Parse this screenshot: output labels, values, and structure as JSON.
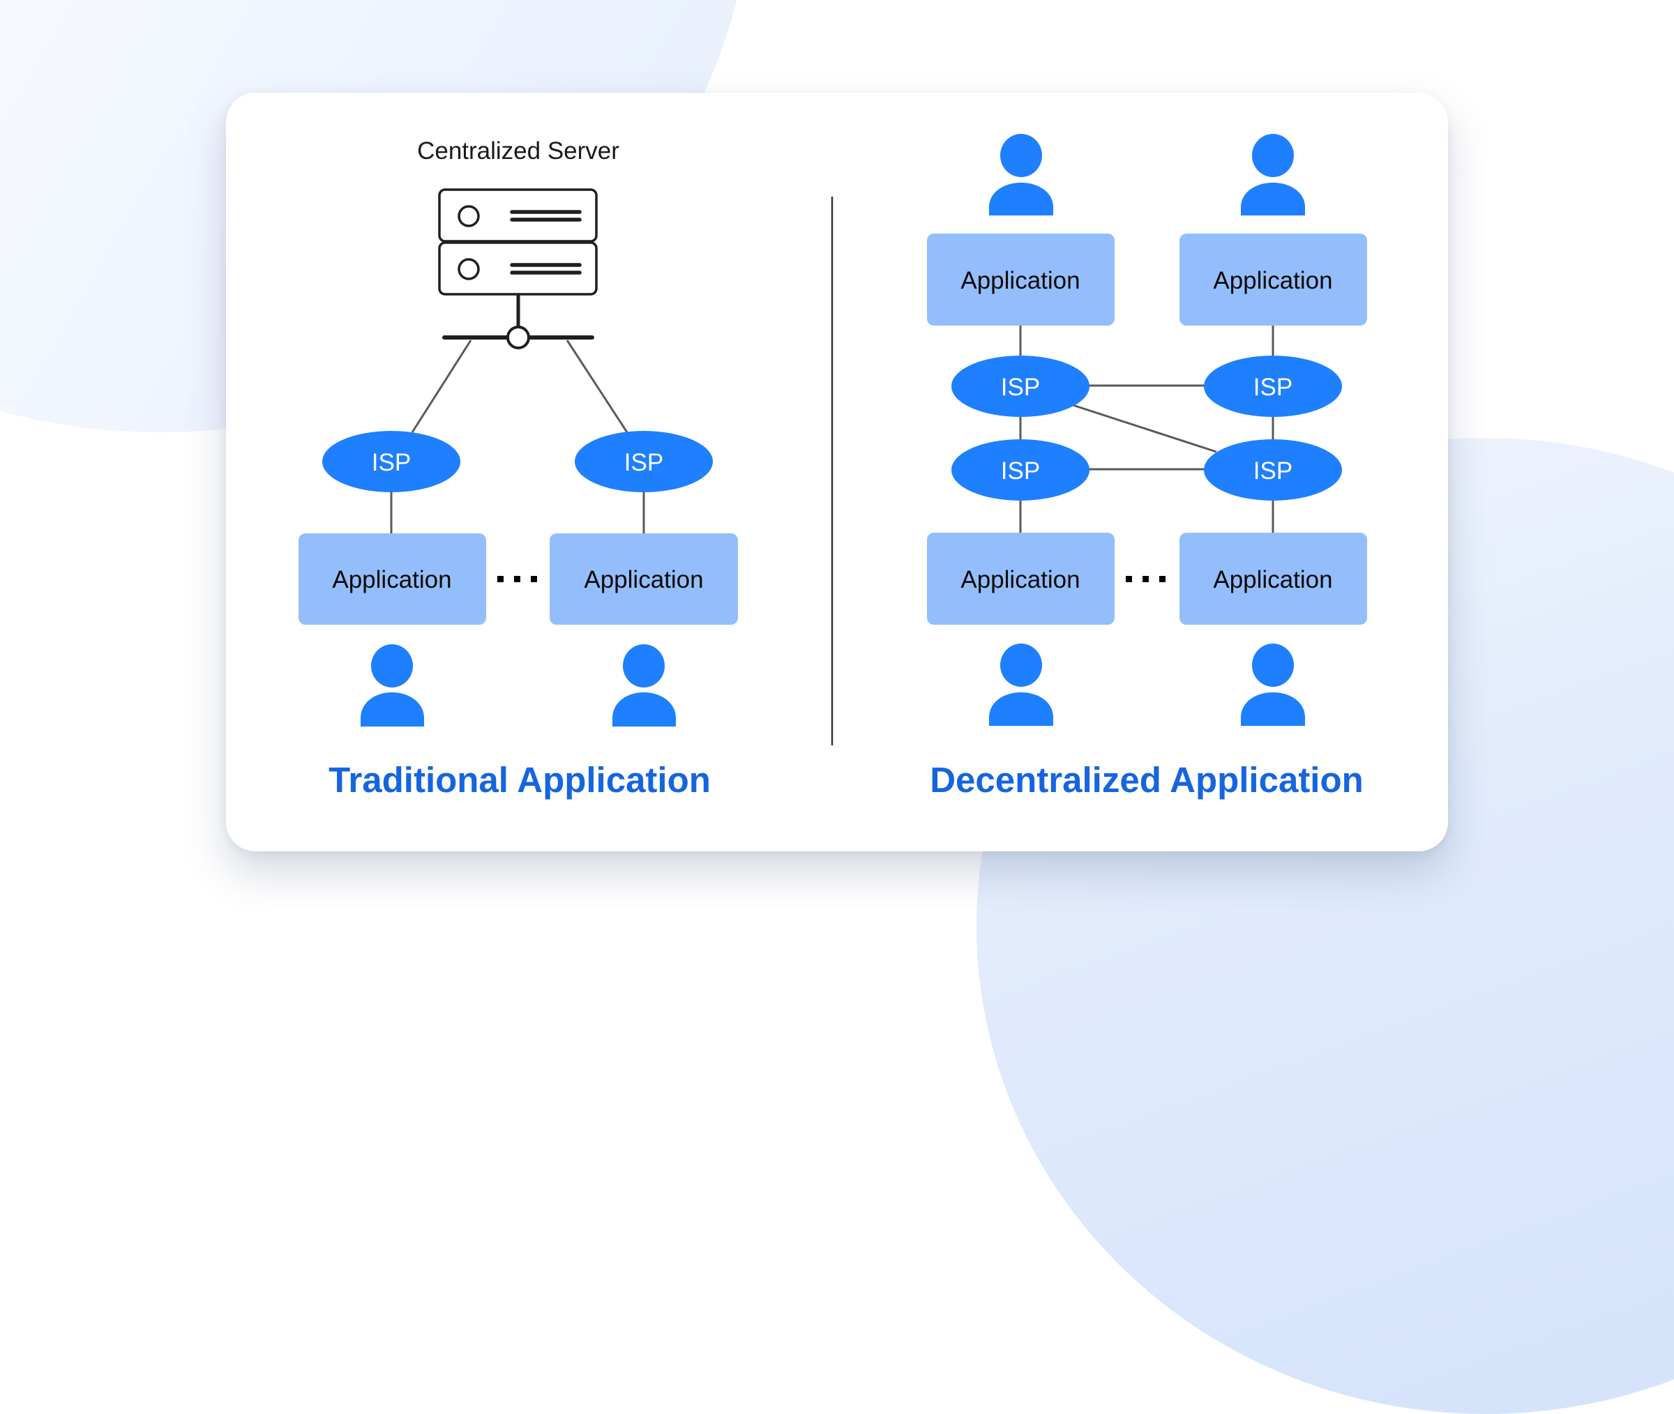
{
  "colors": {
    "accent": "#1565DE",
    "isp_fill": "#1E7FFF",
    "app_fill": "#94BEFB",
    "user_fill": "#1E7FFF",
    "line": "#5a5a5a",
    "server_stroke": "#1f1f1f",
    "divider": "#333333"
  },
  "traditional": {
    "title": "Traditional Application",
    "server_label": "Centralized Server",
    "isp_label": "ISP",
    "app_label": "Application",
    "ellipsis": "...",
    "isps": [
      "ISP",
      "ISP"
    ],
    "apps": [
      "Application",
      "Application"
    ],
    "users": [
      "user",
      "user"
    ]
  },
  "decentralized": {
    "title": "Decentralized Application",
    "top_apps": [
      "Application",
      "Application"
    ],
    "isps_row1": [
      "ISP",
      "ISP"
    ],
    "isps_row2": [
      "ISP",
      "ISP"
    ],
    "bottom_apps": [
      "Application",
      "Application"
    ],
    "ellipsis": "...",
    "users_top": [
      "user",
      "user"
    ],
    "users_bottom": [
      "user",
      "user"
    ]
  }
}
